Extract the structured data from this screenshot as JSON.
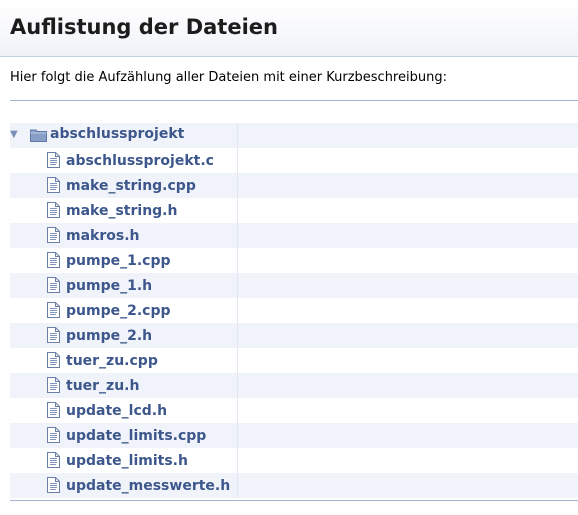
{
  "header": {
    "title": "Auflistung der Dateien"
  },
  "intro": "Hier folgt die Aufzählung aller Dateien mit einer Kurzbeschreibung:",
  "tree": {
    "folder": {
      "name": "abschlussprojekt",
      "expanded": true,
      "icon": "folder-icon"
    },
    "files": [
      "abschlussprojekt.c",
      "make_string.cpp",
      "make_string.h",
      "makros.h",
      "pumpe_1.cpp",
      "pumpe_1.h",
      "pumpe_2.cpp",
      "pumpe_2.h",
      "tuer_zu.cpp",
      "tuer_zu.h",
      "update_lcd.h",
      "update_limits.cpp",
      "update_limits.h",
      "update_messwerte.h"
    ]
  },
  "colors": {
    "link": "#3d578c",
    "row_alt": "#f0f3f9",
    "divider": "#a3b4d7"
  }
}
